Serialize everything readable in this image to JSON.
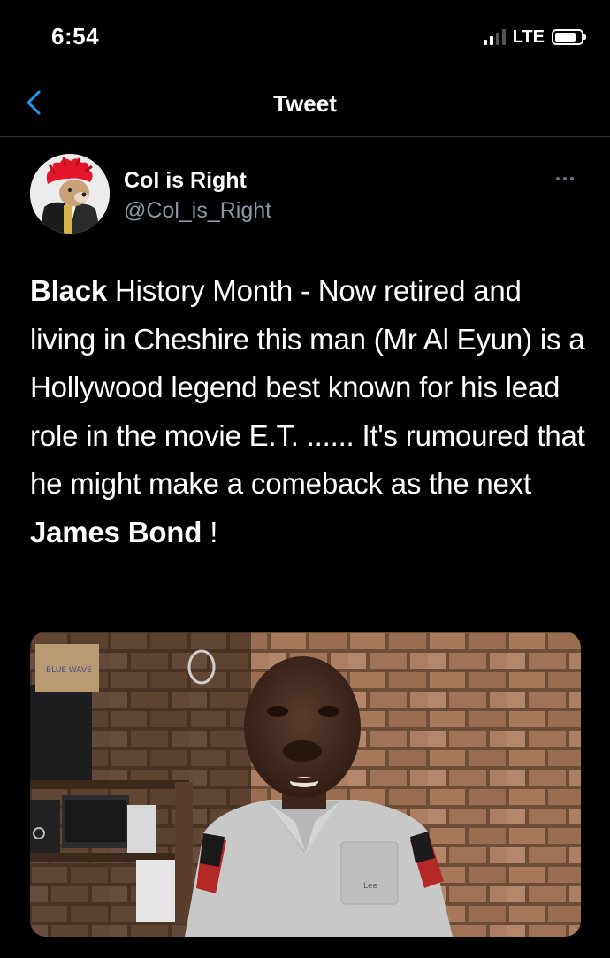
{
  "status_bar": {
    "time": "6:54",
    "network": "LTE",
    "signal_bars_active": 2,
    "signal_bars_total": 4,
    "battery_level": 0.85
  },
  "nav": {
    "title": "Tweet",
    "back_icon": "chevron-left-icon",
    "accent_color": "#1d9bf0"
  },
  "tweet": {
    "author": {
      "display_name": "Col is Right",
      "handle": "@Col_is_Right"
    },
    "more_icon": "ellipsis-icon",
    "text_segments": [
      {
        "text": "Black",
        "bold": true
      },
      {
        "text": " History Month - Now retired and living in Cheshire this man (Mr Al Eyun) is a Hollywood legend best known for his lead role in the movie E.T.  ...... It's rumoured that he might make a comeback as the next ",
        "bold": false
      },
      {
        "text": "James Bond",
        "bold": true
      },
      {
        "text": " !",
        "bold": false
      }
    ],
    "media": {
      "box_label": "BLUE WAVE",
      "shirt_label": "Lee"
    }
  },
  "colors": {
    "background": "#000000",
    "text": "#ffffff",
    "secondary_text": "#8b98a5",
    "divider": "#2f3336"
  }
}
